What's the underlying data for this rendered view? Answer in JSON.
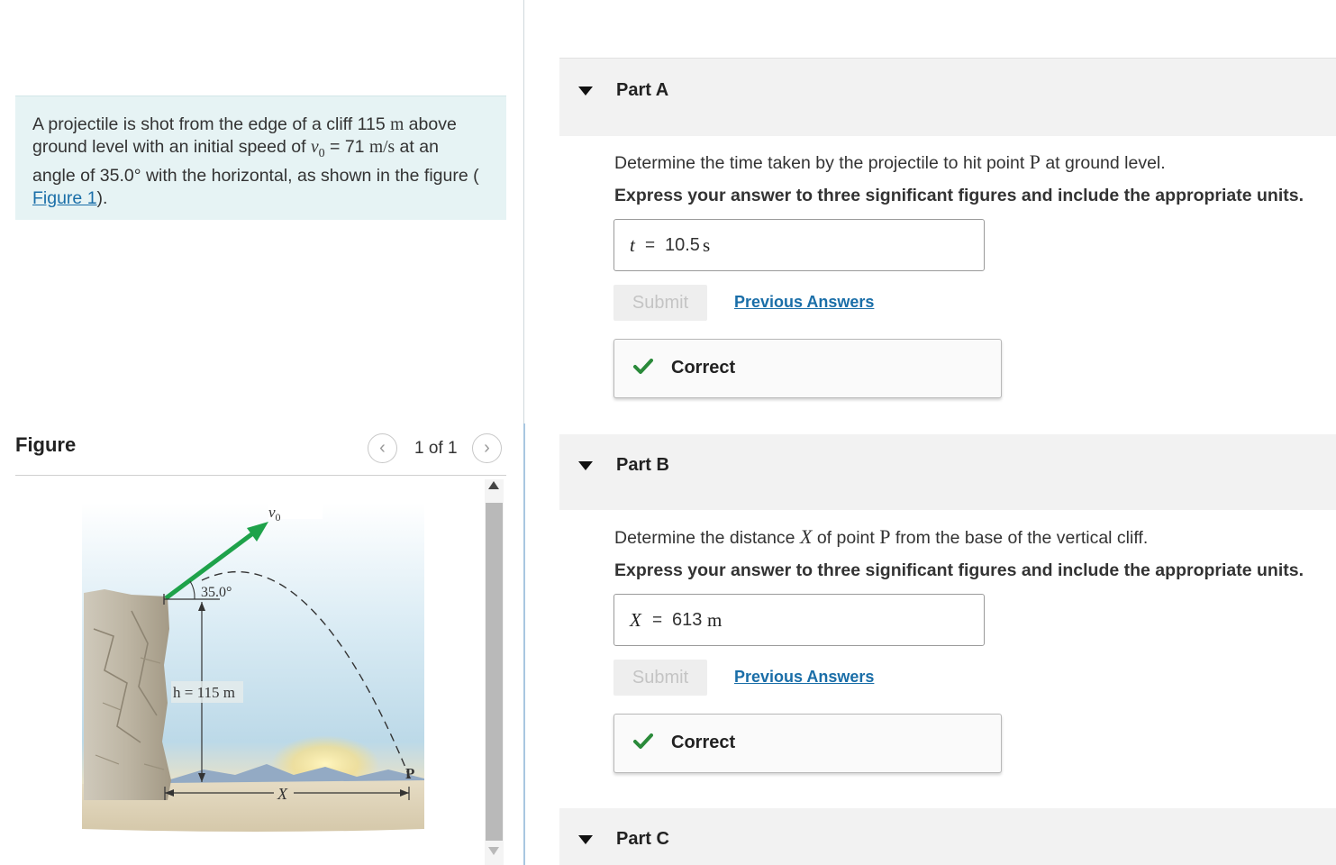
{
  "problem": {
    "text_1": "A projectile is shot from the edge of a cliff 115 ",
    "unit_m": "m",
    "text_2": " above",
    "text_3": "ground level with an initial speed of ",
    "v0_symbol": "v",
    "v0_sub": "0",
    "text_4": " = 71 ",
    "unit_ms": "m/s",
    "text_5": " at an",
    "text_6": "angle of 35.0° with the horizontal, as shown in the figure (",
    "figure_link": "Figure 1",
    "text_7": ")."
  },
  "figure_panel": {
    "title": "Figure",
    "counter": "1 of 1",
    "prev_glyph": "‹",
    "next_glyph": "›"
  },
  "figure": {
    "v0_label": "v",
    "v0_sub": "0",
    "angle_label": "35.0°",
    "height_label": "h = 115 m",
    "point_label": "P",
    "distance_label": "X"
  },
  "parts": [
    {
      "title": "Part A",
      "question_1": "Determine the time taken by the projectile to hit point ",
      "question_sym": "P",
      "question_2": " at ground level.",
      "instruction": "Express your answer to three significant figures and include the appropriate units.",
      "answer_var": "t",
      "answer_eq": "=",
      "answer_value": "10.5",
      "answer_unit": "s",
      "submit_label": "Submit",
      "previous_answers": "Previous Answers",
      "feedback": "Correct"
    },
    {
      "title": "Part B",
      "question_1": "Determine the distance ",
      "question_sym_x": "X",
      "question_mid": " of point ",
      "question_sym": "P",
      "question_2": " from the base of the vertical cliff.",
      "instruction": "Express your answer to three significant figures and include the appropriate units.",
      "answer_var": "X",
      "answer_eq": "=",
      "answer_value": "613",
      "answer_unit": "m",
      "submit_label": "Submit",
      "previous_answers": "Previous Answers",
      "feedback": "Correct"
    },
    {
      "title": "Part C"
    }
  ],
  "colors": {
    "link": "#1a6ea8",
    "correct_check": "#2a8a3a",
    "velocity_arrow": "#1ea24a",
    "problem_bg": "#e6f3f4"
  }
}
